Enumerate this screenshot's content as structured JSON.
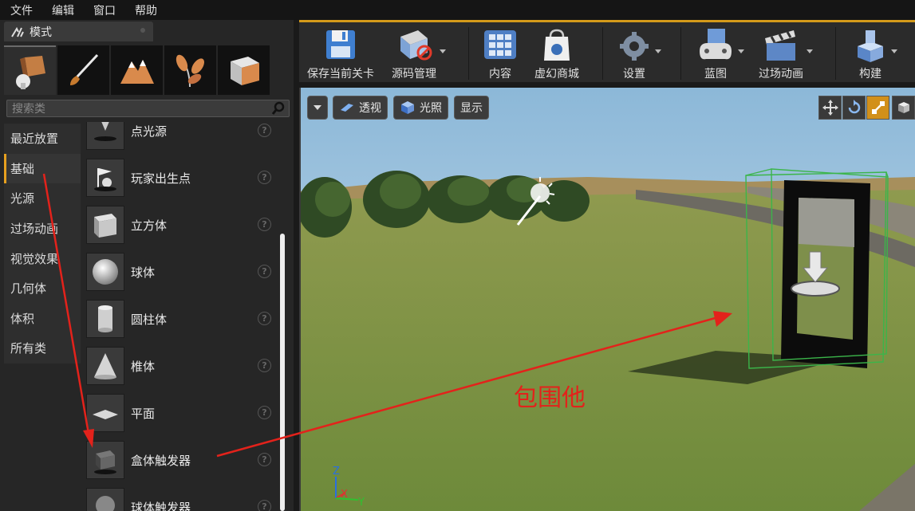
{
  "menu": [
    "文件",
    "编辑",
    "窗口",
    "帮助"
  ],
  "panel": {
    "tab_title": "模式",
    "search_placeholder": "搜索类",
    "categories": [
      "最近放置",
      "基础",
      "光源",
      "过场动画",
      "视觉效果",
      "几何体",
      "体积",
      "所有类"
    ],
    "selected_category": "基础",
    "items": [
      {
        "label": "点光源",
        "icon": "point-light-icon"
      },
      {
        "label": "玩家出生点",
        "icon": "player-start-icon"
      },
      {
        "label": "立方体",
        "icon": "cube-icon"
      },
      {
        "label": "球体",
        "icon": "sphere-icon"
      },
      {
        "label": "圆柱体",
        "icon": "cylinder-icon"
      },
      {
        "label": "椎体",
        "icon": "cone-icon"
      },
      {
        "label": "平面",
        "icon": "plane-icon"
      },
      {
        "label": "盒体触发器",
        "icon": "box-trigger-icon"
      },
      {
        "label": "球体触发器",
        "icon": "sphere-trigger-icon"
      }
    ]
  },
  "toolbar": {
    "save": "保存当前关卡",
    "source_control": "源码管理",
    "content": "内容",
    "marketplace": "虚幻商城",
    "settings": "设置",
    "blueprints": "蓝图",
    "cinematics": "过场动画",
    "build": "构建"
  },
  "viewport": {
    "perspective": "透视",
    "lit": "光照",
    "show": "显示",
    "axis_z": "Z",
    "axis_x": "X",
    "axis_y": "Y"
  },
  "annotation": "包围他",
  "colors": {
    "accent": "#e6a01f",
    "annotation": "#e3221b",
    "selection": "#3bb54a"
  }
}
